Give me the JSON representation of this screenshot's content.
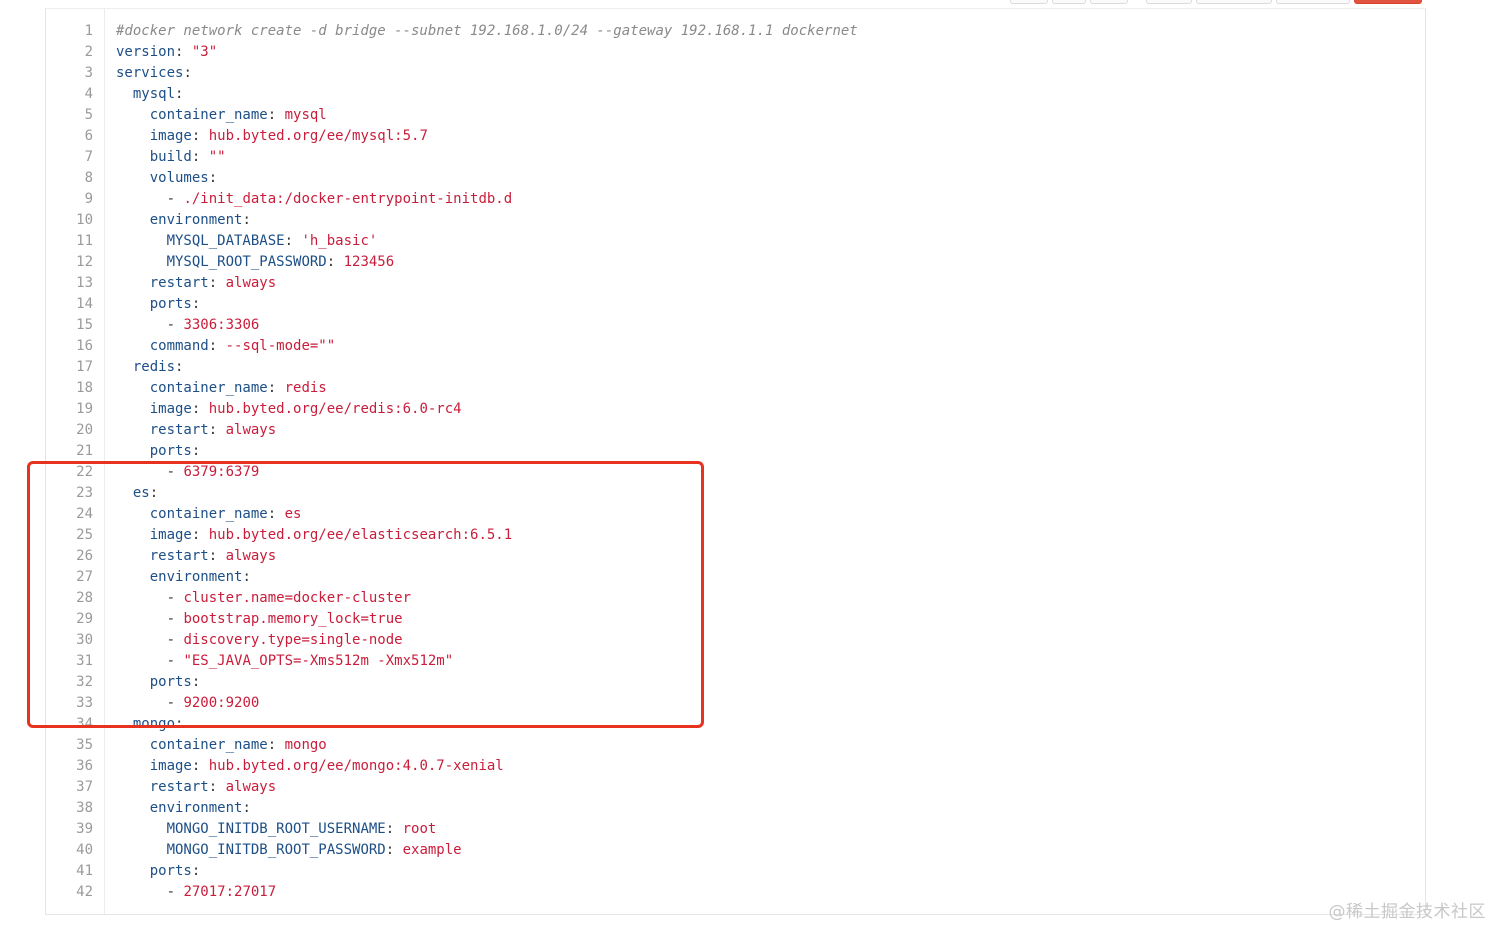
{
  "colors": {
    "key": "#1d4f86",
    "value": "#c91d3b",
    "comment": "#8a8a8a",
    "highlight": "#e6321f"
  },
  "lines": [
    {
      "n": "1",
      "key": "",
      "sep": "",
      "val": "",
      "comment": "#docker network create -d bridge --subnet 192.168.1.0/24 --gateway 192.168.1.1 dockernet"
    },
    {
      "n": "2",
      "key": "version",
      "sep": ": ",
      "val": "\"3\""
    },
    {
      "n": "3",
      "key": "services",
      "sep": ":",
      "val": ""
    },
    {
      "n": "4",
      "indent": "  ",
      "key": "mysql",
      "sep": ":",
      "val": ""
    },
    {
      "n": "5",
      "indent": "    ",
      "key": "container_name",
      "sep": ": ",
      "val": "mysql"
    },
    {
      "n": "6",
      "indent": "    ",
      "key": "image",
      "sep": ": ",
      "val": "hub.byted.org/ee/mysql:5.7"
    },
    {
      "n": "7",
      "indent": "    ",
      "key": "build",
      "sep": ": ",
      "val": "\"\""
    },
    {
      "n": "8",
      "indent": "    ",
      "key": "volumes",
      "sep": ":",
      "val": ""
    },
    {
      "n": "9",
      "indent": "      ",
      "key": "",
      "dash": "- ",
      "val": "./init_data:/docker-entrypoint-initdb.d"
    },
    {
      "n": "10",
      "indent": "    ",
      "key": "environment",
      "sep": ":",
      "val": ""
    },
    {
      "n": "11",
      "indent": "      ",
      "key": "MYSQL_DATABASE",
      "sep": ": ",
      "val": "'h_basic'"
    },
    {
      "n": "12",
      "indent": "      ",
      "key": "MYSQL_ROOT_PASSWORD",
      "sep": ": ",
      "val": "123456"
    },
    {
      "n": "13",
      "indent": "    ",
      "key": "restart",
      "sep": ": ",
      "val": "always"
    },
    {
      "n": "14",
      "indent": "    ",
      "key": "ports",
      "sep": ":",
      "val": ""
    },
    {
      "n": "15",
      "indent": "      ",
      "key": "",
      "dash": "- ",
      "val": "3306:3306"
    },
    {
      "n": "16",
      "indent": "    ",
      "key": "command",
      "sep": ": ",
      "val": "--sql-mode=\"\""
    },
    {
      "n": "17",
      "indent": "  ",
      "key": "redis",
      "sep": ":",
      "val": ""
    },
    {
      "n": "18",
      "indent": "    ",
      "key": "container_name",
      "sep": ": ",
      "val": "redis"
    },
    {
      "n": "19",
      "indent": "    ",
      "key": "image",
      "sep": ": ",
      "val": "hub.byted.org/ee/redis:6.0-rc4"
    },
    {
      "n": "20",
      "indent": "    ",
      "key": "restart",
      "sep": ": ",
      "val": "always"
    },
    {
      "n": "21",
      "indent": "    ",
      "key": "ports",
      "sep": ":",
      "val": ""
    },
    {
      "n": "22",
      "indent": "      ",
      "key": "",
      "dash": "- ",
      "val": "6379:6379"
    },
    {
      "n": "23",
      "indent": "  ",
      "key": "es",
      "sep": ":",
      "val": ""
    },
    {
      "n": "24",
      "indent": "    ",
      "key": "container_name",
      "sep": ": ",
      "val": "es"
    },
    {
      "n": "25",
      "indent": "    ",
      "key": "image",
      "sep": ": ",
      "val": "hub.byted.org/ee/elasticsearch:6.5.1"
    },
    {
      "n": "26",
      "indent": "    ",
      "key": "restart",
      "sep": ": ",
      "val": "always"
    },
    {
      "n": "27",
      "indent": "    ",
      "key": "environment",
      "sep": ":",
      "val": ""
    },
    {
      "n": "28",
      "indent": "      ",
      "key": "",
      "dash": "- ",
      "val": "cluster.name=docker-cluster"
    },
    {
      "n": "29",
      "indent": "      ",
      "key": "",
      "dash": "- ",
      "val": "bootstrap.memory_lock=true"
    },
    {
      "n": "30",
      "indent": "      ",
      "key": "",
      "dash": "- ",
      "val": "discovery.type=single-node"
    },
    {
      "n": "31",
      "indent": "      ",
      "key": "",
      "dash": "- ",
      "val": "\"ES_JAVA_OPTS=-Xms512m -Xmx512m\""
    },
    {
      "n": "32",
      "indent": "    ",
      "key": "ports",
      "sep": ":",
      "val": ""
    },
    {
      "n": "33",
      "indent": "      ",
      "key": "",
      "dash": "- ",
      "val": "9200:9200"
    },
    {
      "n": "34",
      "indent": "  ",
      "key": "mongo",
      "sep": ":",
      "val": ""
    },
    {
      "n": "35",
      "indent": "    ",
      "key": "container_name",
      "sep": ": ",
      "val": "mongo"
    },
    {
      "n": "36",
      "indent": "    ",
      "key": "image",
      "sep": ": ",
      "val": "hub.byted.org/ee/mongo:4.0.7-xenial"
    },
    {
      "n": "37",
      "indent": "    ",
      "key": "restart",
      "sep": ": ",
      "val": "always"
    },
    {
      "n": "38",
      "indent": "    ",
      "key": "environment",
      "sep": ":",
      "val": ""
    },
    {
      "n": "39",
      "indent": "      ",
      "key": "MONGO_INITDB_ROOT_USERNAME",
      "sep": ": ",
      "val": "root"
    },
    {
      "n": "40",
      "indent": "      ",
      "key": "MONGO_INITDB_ROOT_PASSWORD",
      "sep": ": ",
      "val": "example"
    },
    {
      "n": "41",
      "indent": "    ",
      "key": "ports",
      "sep": ":",
      "val": ""
    },
    {
      "n": "42",
      "indent": "      ",
      "key": "",
      "dash": "- ",
      "val": "27017:27017"
    }
  ],
  "watermark": "@稀土掘金技术社区"
}
